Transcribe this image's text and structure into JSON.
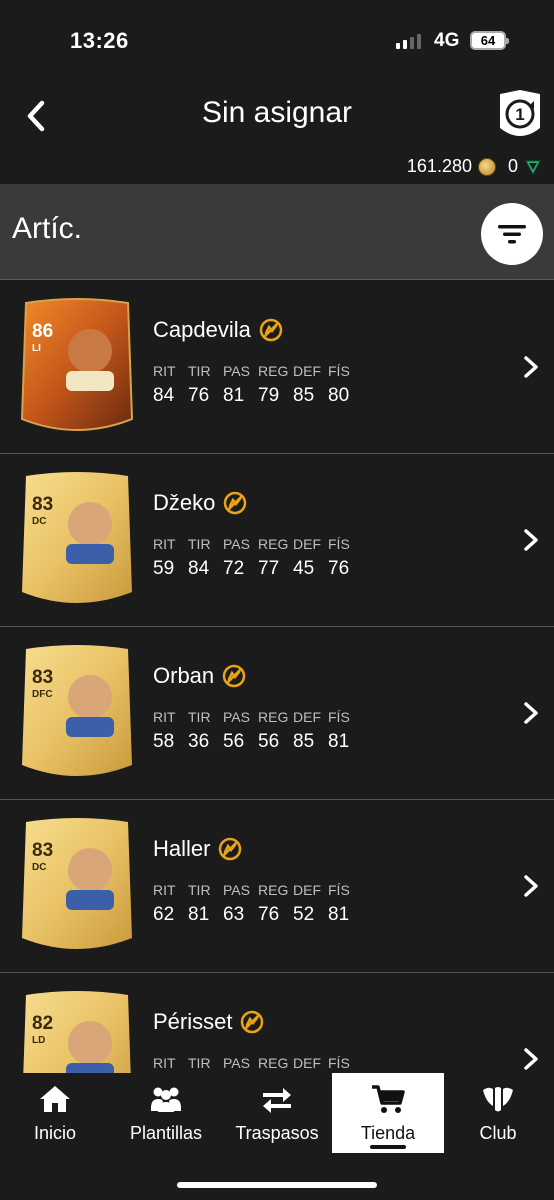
{
  "status": {
    "time": "13:26",
    "network": "4G",
    "battery": "64"
  },
  "header": {
    "title": "Sin asignar",
    "coins": "161.280",
    "points": "0"
  },
  "section": {
    "title": "Artíc."
  },
  "stat_labels": [
    "RIT",
    "TIR",
    "PAS",
    "REG",
    "DEF",
    "FÍS"
  ],
  "players": [
    {
      "name": "Capdevila",
      "rating": "86",
      "position": "LI",
      "stats": [
        "84",
        "76",
        "81",
        "79",
        "85",
        "80"
      ],
      "special": true
    },
    {
      "name": "Džeko",
      "rating": "83",
      "position": "DC",
      "stats": [
        "59",
        "84",
        "72",
        "77",
        "45",
        "76"
      ],
      "special": false
    },
    {
      "name": "Orban",
      "rating": "83",
      "position": "DFC",
      "stats": [
        "58",
        "36",
        "56",
        "56",
        "85",
        "81"
      ],
      "special": false
    },
    {
      "name": "Haller",
      "rating": "83",
      "position": "DC",
      "stats": [
        "62",
        "81",
        "63",
        "76",
        "52",
        "81"
      ],
      "special": false
    },
    {
      "name": "Périsset",
      "rating": "82",
      "position": "LD",
      "stats": [
        "",
        "",
        "",
        "",
        "",
        ""
      ],
      "special": false
    }
  ],
  "nav": {
    "items": [
      {
        "label": "Inicio",
        "icon": "home-icon"
      },
      {
        "label": "Plantillas",
        "icon": "squad-icon"
      },
      {
        "label": "Traspasos",
        "icon": "transfer-icon"
      },
      {
        "label": "Tienda",
        "icon": "cart-icon"
      },
      {
        "label": "Club",
        "icon": "club-icon"
      }
    ],
    "active": "Tienda"
  },
  "colors": {
    "background": "#1b1b1b",
    "section": "#3a3a3a",
    "gold": "#e8a317",
    "card_gold": "#e9c266",
    "special_card": "#d8701e"
  }
}
